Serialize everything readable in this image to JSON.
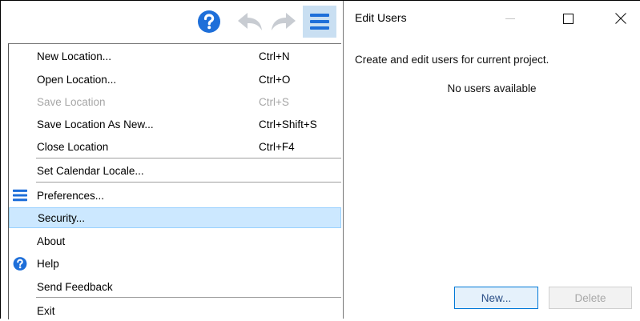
{
  "toolbar": {
    "buttons": [
      {
        "name": "help",
        "icon": "help-icon",
        "color": "#1e6fd9"
      },
      {
        "name": "undo",
        "icon": "undo-arrow-icon",
        "color": "#c8ccd2"
      },
      {
        "name": "redo",
        "icon": "redo-arrow-icon",
        "color": "#c8ccd2"
      },
      {
        "name": "menu",
        "icon": "hamburger-menu-icon",
        "color": "#1e6fd9",
        "active": true
      }
    ]
  },
  "menu": {
    "items": [
      {
        "label": "New Location...",
        "shortcut": "Ctrl+N"
      },
      {
        "label": "Open Location...",
        "shortcut": "Ctrl+O"
      },
      {
        "label": "Save Location",
        "shortcut": "Ctrl+S",
        "disabled": true
      },
      {
        "label": "Save Location As New...",
        "shortcut": "Ctrl+Shift+S"
      },
      {
        "label": "Close Location",
        "shortcut": "Ctrl+F4"
      },
      {
        "label": "Set Calendar Locale...",
        "shortcut": ""
      },
      {
        "label": "Preferences...",
        "shortcut": "",
        "icon": "preferences-list-icon"
      },
      {
        "label": "Security...",
        "shortcut": "",
        "highlighted": true
      },
      {
        "label": "About",
        "shortcut": ""
      },
      {
        "label": "Help",
        "shortcut": "",
        "icon": "help-icon"
      },
      {
        "label": "Send Feedback",
        "shortcut": ""
      },
      {
        "label": "Exit",
        "shortcut": ""
      }
    ]
  },
  "dialog": {
    "title": "Edit Users",
    "controls": {
      "minimize": "—",
      "maximize": "☐",
      "close": "✕"
    },
    "description": "Create and edit users for current project.",
    "empty_message": "No users available",
    "buttons": {
      "new": "New...",
      "delete": "Delete"
    }
  },
  "colors": {
    "accent": "#1e6fd9",
    "highlight": "#cce8ff",
    "highlight_border": "#99d1ff",
    "disabled_text": "#a6a6a6"
  }
}
